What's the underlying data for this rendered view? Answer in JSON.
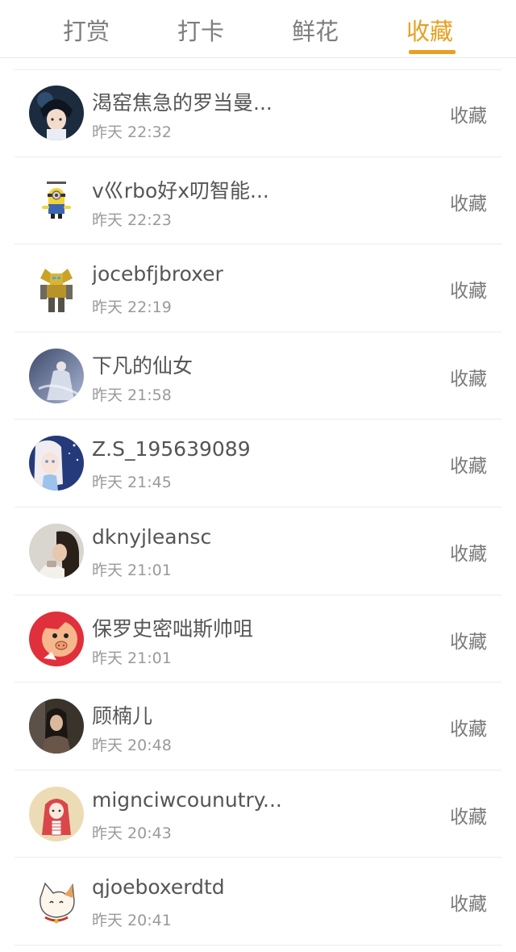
{
  "tabs": [
    {
      "label": "打赏"
    },
    {
      "label": "打卡"
    },
    {
      "label": "鲜花"
    },
    {
      "label": "收藏",
      "active": true
    }
  ],
  "colors": {
    "accent": "#e8a021",
    "text": "#555555",
    "muted": "#9a9a9a"
  },
  "list": [
    {
      "name": "渴窑焦急的罗当曼...",
      "time": "昨天 22:32",
      "action": "收藏",
      "avatar": "anime-boy-avatar"
    },
    {
      "name": "v巛rbo好x叨智能...",
      "time": "昨天 22:23",
      "action": "收藏",
      "avatar": "minion-avatar"
    },
    {
      "name": "jocebfjbroxer",
      "time": "昨天 22:19",
      "action": "收藏",
      "avatar": "robot-avatar"
    },
    {
      "name": "下凡的仙女",
      "time": "昨天 21:58",
      "action": "收藏",
      "avatar": "fairy-avatar"
    },
    {
      "name": "Z.S_195639089",
      "time": "昨天 21:45",
      "action": "收藏",
      "avatar": "princess-avatar"
    },
    {
      "name": "dknyjleansc",
      "time": "昨天 21:01",
      "action": "收藏",
      "avatar": "girl-photo-avatar"
    },
    {
      "name": "保罗史密咄斯帅咀",
      "time": "昨天 21:01",
      "action": "收藏",
      "avatar": "cartoon-pig-avatar"
    },
    {
      "name": "顾楠儿",
      "time": "昨天 20:48",
      "action": "收藏",
      "avatar": "woman-photo-avatar"
    },
    {
      "name": "mignciwcounutry...",
      "time": "昨天 20:43",
      "action": "收藏",
      "avatar": "red-hair-girl-avatar"
    },
    {
      "name": "qjoeboxerdtd",
      "time": "昨天 20:41",
      "action": "收藏",
      "avatar": "cat-avatar"
    }
  ]
}
